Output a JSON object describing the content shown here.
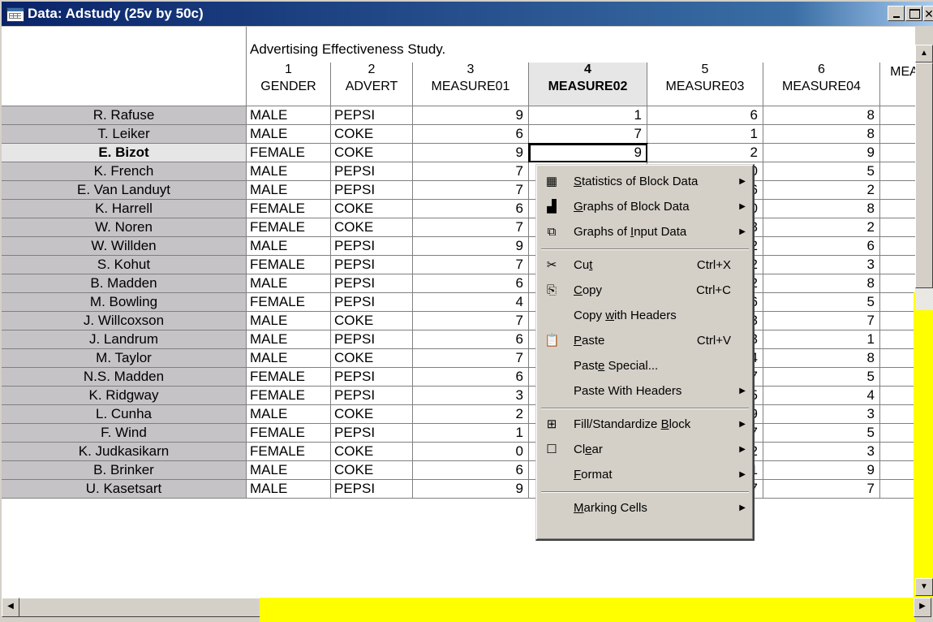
{
  "window": {
    "title": "Data: Adstudy (25v by 50c)",
    "caption_buttons": [
      "minimize",
      "maximize",
      "close"
    ]
  },
  "spreadsheet": {
    "study_title": "Advertising Effectiveness Study.",
    "columns": [
      {
        "num": "1",
        "name": "GENDER"
      },
      {
        "num": "2",
        "name": "ADVERT"
      },
      {
        "num": "3",
        "name": "MEASURE01"
      },
      {
        "num": "4",
        "name": "MEASURE02"
      },
      {
        "num": "5",
        "name": "MEASURE03"
      },
      {
        "num": "6",
        "name": "MEASURE04"
      },
      {
        "num": "",
        "name": "MEA"
      }
    ],
    "selected_column": "4",
    "selected_row": "E. Bizot",
    "rows": [
      {
        "name": "R. Rafuse",
        "gender": "MALE",
        "advert": "PEPSI",
        "m1": "9",
        "m2": "1",
        "m3": "6",
        "m4": "8"
      },
      {
        "name": "T. Leiker",
        "gender": "MALE",
        "advert": "COKE",
        "m1": "6",
        "m2": "7",
        "m3": "1",
        "m4": "8"
      },
      {
        "name": "E. Bizot",
        "gender": "FEMALE",
        "advert": "COKE",
        "m1": "9",
        "m2": "9",
        "m3": "2",
        "m4": "9"
      },
      {
        "name": "K. French",
        "gender": "MALE",
        "advert": "PEPSI",
        "m1": "7",
        "m2": "",
        "m3": "0",
        "m4": "5"
      },
      {
        "name": "E. Van Landuyt",
        "gender": "MALE",
        "advert": "PEPSI",
        "m1": "7",
        "m2": "",
        "m3": "6",
        "m4": "2"
      },
      {
        "name": "K. Harrell",
        "gender": "FEMALE",
        "advert": "COKE",
        "m1": "6",
        "m2": "",
        "m3": "0",
        "m4": "8"
      },
      {
        "name": "W. Noren",
        "gender": "FEMALE",
        "advert": "COKE",
        "m1": "7",
        "m2": "",
        "m3": "3",
        "m4": "2"
      },
      {
        "name": "W. Willden",
        "gender": "MALE",
        "advert": "PEPSI",
        "m1": "9",
        "m2": "",
        "m3": "2",
        "m4": "6"
      },
      {
        "name": "S. Kohut",
        "gender": "FEMALE",
        "advert": "PEPSI",
        "m1": "7",
        "m2": "",
        "m3": "2",
        "m4": "3"
      },
      {
        "name": "B. Madden",
        "gender": "MALE",
        "advert": "PEPSI",
        "m1": "6",
        "m2": "",
        "m3": "2",
        "m4": "8"
      },
      {
        "name": "M. Bowling",
        "gender": "FEMALE",
        "advert": "PEPSI",
        "m1": "4",
        "m2": "",
        "m3": "6",
        "m4": "5"
      },
      {
        "name": "J. Willcoxson",
        "gender": "MALE",
        "advert": "COKE",
        "m1": "7",
        "m2": "",
        "m3": "3",
        "m4": "7"
      },
      {
        "name": "J. Landrum",
        "gender": "MALE",
        "advert": "PEPSI",
        "m1": "6",
        "m2": "",
        "m3": "3",
        "m4": "1"
      },
      {
        "name": "M. Taylor",
        "gender": "MALE",
        "advert": "COKE",
        "m1": "7",
        "m2": "",
        "m3": "4",
        "m4": "8"
      },
      {
        "name": "N.S. Madden",
        "gender": "FEMALE",
        "advert": "PEPSI",
        "m1": "6",
        "m2": "",
        "m3": "7",
        "m4": "5"
      },
      {
        "name": "K. Ridgway",
        "gender": "FEMALE",
        "advert": "PEPSI",
        "m1": "3",
        "m2": "",
        "m3": "5",
        "m4": "4"
      },
      {
        "name": "L. Cunha",
        "gender": "MALE",
        "advert": "COKE",
        "m1": "2",
        "m2": "",
        "m3": "9",
        "m4": "3"
      },
      {
        "name": "F. Wind",
        "gender": "FEMALE",
        "advert": "PEPSI",
        "m1": "1",
        "m2": "",
        "m3": "7",
        "m4": "5"
      },
      {
        "name": "K. Judkasikarn",
        "gender": "FEMALE",
        "advert": "COKE",
        "m1": "0",
        "m2": "",
        "m3": "2",
        "m4": "3"
      },
      {
        "name": "B. Brinker",
        "gender": "MALE",
        "advert": "COKE",
        "m1": "6",
        "m2": "8",
        "m3": "1",
        "m4": "9"
      },
      {
        "name": "U. Kasetsart",
        "gender": "MALE",
        "advert": "PEPSI",
        "m1": "9",
        "m2": "2",
        "m3": "7",
        "m4": "7"
      }
    ]
  },
  "context_menu": {
    "items": [
      {
        "icon": "stats-table-icon",
        "label": "Statistics of Block Data",
        "shortcut": "",
        "submenu": true,
        "mnemonic": "S"
      },
      {
        "icon": "bar-graph-icon",
        "label": "Graphs of Block Data",
        "shortcut": "",
        "submenu": true,
        "mnemonic": "G"
      },
      {
        "icon": "input-graph-icon",
        "label": "Graphs of Input Data",
        "shortcut": "",
        "submenu": true,
        "mnemonic": "I"
      },
      {
        "separator": true
      },
      {
        "icon": "scissors-icon",
        "label": "Cut",
        "shortcut": "Ctrl+X",
        "submenu": false,
        "mnemonic": "t"
      },
      {
        "icon": "copy-icon",
        "label": "Copy",
        "shortcut": "Ctrl+C",
        "submenu": false,
        "mnemonic": "C"
      },
      {
        "icon": "",
        "label": "Copy with Headers",
        "shortcut": "",
        "submenu": false,
        "mnemonic": "w"
      },
      {
        "icon": "paste-icon",
        "label": "Paste",
        "shortcut": "Ctrl+V",
        "submenu": false,
        "mnemonic": "P"
      },
      {
        "icon": "",
        "label": "Paste Special...",
        "shortcut": "",
        "submenu": false,
        "mnemonic": "e"
      },
      {
        "icon": "",
        "label": "Paste With Headers",
        "shortcut": "",
        "submenu": true,
        "mnemonic": ""
      },
      {
        "separator": true
      },
      {
        "icon": "fill-block-icon",
        "label": "Fill/Standardize Block",
        "shortcut": "",
        "submenu": true,
        "mnemonic": "B"
      },
      {
        "icon": "clear-box-icon",
        "label": "Clear",
        "shortcut": "",
        "submenu": true,
        "mnemonic": "e"
      },
      {
        "icon": "",
        "label": "Format",
        "shortcut": "",
        "submenu": true,
        "mnemonic": "F"
      },
      {
        "separator": true
      },
      {
        "icon": "",
        "label": "Marking Cells",
        "shortcut": "",
        "submenu": true,
        "mnemonic": "M"
      }
    ]
  },
  "colors": {
    "title_bar": "#0a246a",
    "highlight_yellow": "#ffff00",
    "row_header_bg": "#c6c3c6"
  }
}
